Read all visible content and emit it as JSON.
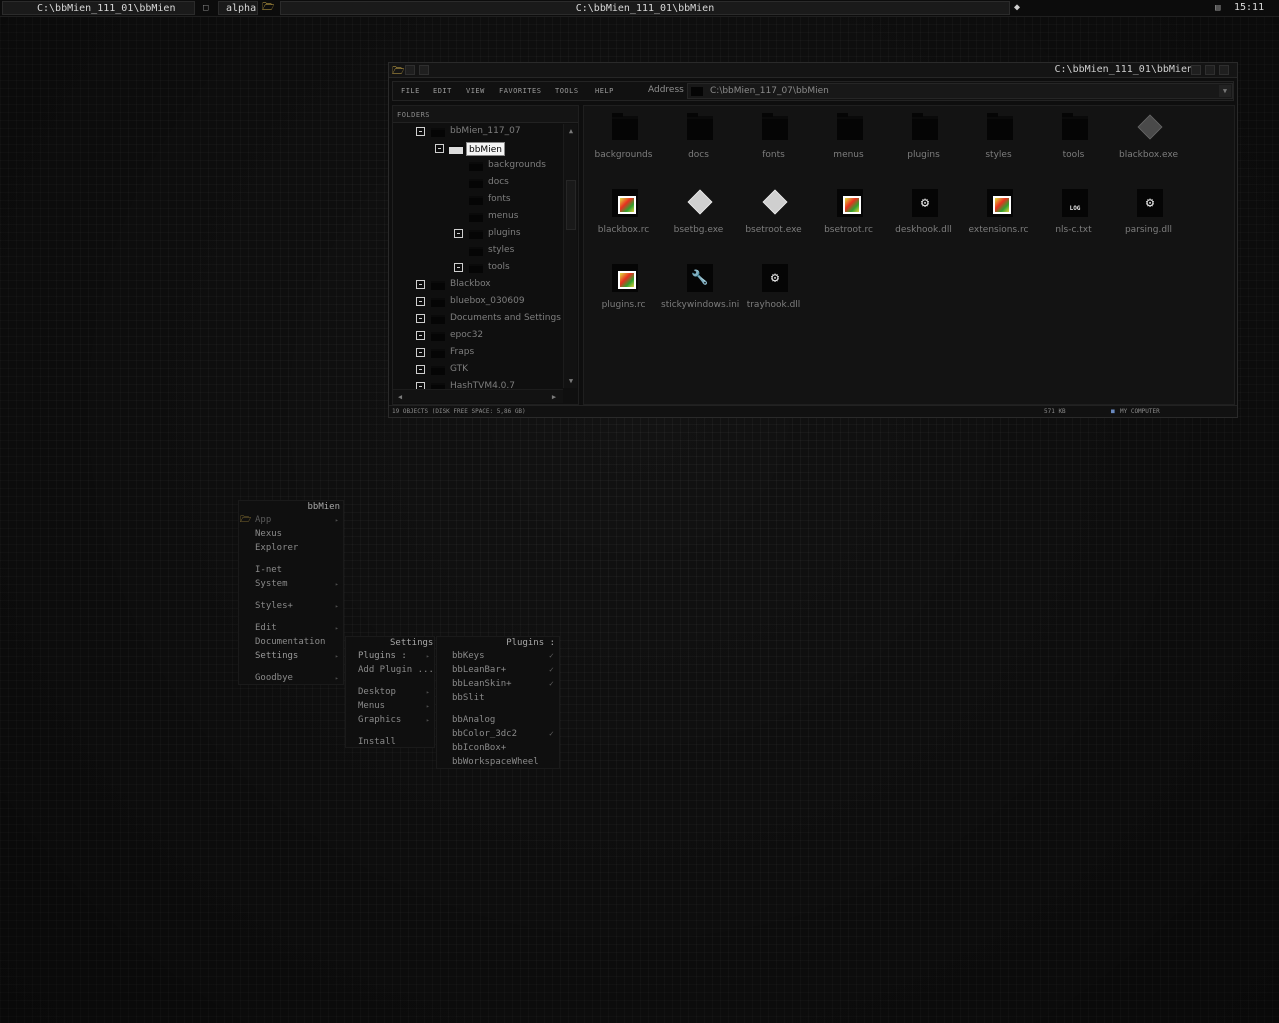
{
  "taskbar": {
    "task_left": "C:\\bbMien_111_01\\bbMien",
    "workspace": "alpha",
    "task_center": "C:\\bbMien_111_01\\bbMien",
    "clock": "15:11"
  },
  "explorer": {
    "title": "C:\\bbMien_111_01\\bbMien",
    "menu": [
      "FILE",
      "EDIT",
      "VIEW",
      "FAVORITES",
      "TOOLS",
      "HELP"
    ],
    "address_label": "Address",
    "address_value": "C:\\bbMien_117_07\\bbMien",
    "folders_header": "FOLDERS",
    "tree": [
      {
        "label": "bbMien_117_07",
        "expander": true,
        "selected": false
      },
      {
        "label": "bbMien",
        "expander": true,
        "selected": true
      },
      {
        "label": "backgrounds",
        "expander": false,
        "selected": false
      },
      {
        "label": "docs",
        "expander": false,
        "selected": false
      },
      {
        "label": "fonts",
        "expander": false,
        "selected": false
      },
      {
        "label": "menus",
        "expander": false,
        "selected": false
      },
      {
        "label": "plugins",
        "expander": true,
        "selected": false
      },
      {
        "label": "styles",
        "expander": false,
        "selected": false
      },
      {
        "label": "tools",
        "expander": true,
        "selected": false
      },
      {
        "label": "Blackbox",
        "expander": true,
        "selected": false
      },
      {
        "label": "bluebox_030609",
        "expander": true,
        "selected": false
      },
      {
        "label": "Documents and Settings",
        "expander": true,
        "selected": false
      },
      {
        "label": "epoc32",
        "expander": true,
        "selected": false
      },
      {
        "label": "Fraps",
        "expander": true,
        "selected": false
      },
      {
        "label": "GTK",
        "expander": true,
        "selected": false
      },
      {
        "label": "HashTVM4.0.7",
        "expander": true,
        "selected": false
      }
    ],
    "files": [
      {
        "name": "backgrounds",
        "icon": "folder-icon"
      },
      {
        "name": "docs",
        "icon": "folder-icon"
      },
      {
        "name": "fonts",
        "icon": "folder-icon"
      },
      {
        "name": "menus",
        "icon": "folder-icon"
      },
      {
        "name": "plugins",
        "icon": "folder-icon"
      },
      {
        "name": "styles",
        "icon": "folder-icon"
      },
      {
        "name": "tools",
        "icon": "folder-icon"
      },
      {
        "name": "blackbox.exe",
        "icon": "cube-dark-icon"
      },
      {
        "name": "blackbox.rc",
        "icon": "rc-file-icon"
      },
      {
        "name": "bsetbg.exe",
        "icon": "cube-icon"
      },
      {
        "name": "bsetroot.exe",
        "icon": "cube-icon"
      },
      {
        "name": "bsetroot.rc",
        "icon": "rc-file-icon"
      },
      {
        "name": "deskhook.dll",
        "icon": "gear-file-icon"
      },
      {
        "name": "extensions.rc",
        "icon": "rc-file-icon"
      },
      {
        "name": "nls-c.txt",
        "icon": "log-file-icon"
      },
      {
        "name": "parsing.dll",
        "icon": "gear-file-icon"
      },
      {
        "name": "plugins.rc",
        "icon": "rc-file-icon"
      },
      {
        "name": "stickywindows.ini",
        "icon": "wrench-file-icon"
      },
      {
        "name": "trayhook.dll",
        "icon": "gear-file-icon"
      }
    ],
    "status": {
      "objects": "19 OBJECTS (DISK FREE SPACE: 5,86 GB)",
      "size": "571 KB",
      "location": "MY COMPUTER"
    }
  },
  "menus": {
    "main": {
      "title": "bbMien",
      "items": [
        {
          "label": "App",
          "submenu": true
        },
        {
          "label": "Nexus",
          "submenu": false
        },
        {
          "label": "Explorer",
          "submenu": false
        },
        {
          "label": "I-net",
          "submenu": false
        },
        {
          "label": "System",
          "submenu": true
        },
        {
          "label": "Styles+",
          "submenu": true
        },
        {
          "label": "Edit",
          "submenu": true
        },
        {
          "label": "Documentation",
          "submenu": true
        },
        {
          "label": "Settings",
          "submenu": true
        },
        {
          "label": "Goodbye",
          "submenu": true
        }
      ]
    },
    "settings": {
      "title": "Settings",
      "items": [
        {
          "label": "Plugins :",
          "submenu": true
        },
        {
          "label": "Add Plugin ...",
          "submenu": false
        },
        {
          "label": "Desktop",
          "submenu": true
        },
        {
          "label": "Menus",
          "submenu": true
        },
        {
          "label": "Graphics",
          "submenu": true
        },
        {
          "label": "Install",
          "submenu": false
        }
      ]
    },
    "plugins": {
      "title": "Plugins :",
      "items": [
        {
          "label": "bbKeys",
          "checked": true
        },
        {
          "label": "bbLeanBar+",
          "checked": true
        },
        {
          "label": "bbLeanSkin+",
          "checked": true
        },
        {
          "label": "bbSlit",
          "checked": false
        },
        {
          "label": "bbAnalog",
          "checked": false
        },
        {
          "label": "bbColor_3dc2",
          "checked": true
        },
        {
          "label": "bbIconBox+",
          "checked": false
        },
        {
          "label": "bbWorkspaceWheel",
          "checked": false
        }
      ]
    }
  }
}
